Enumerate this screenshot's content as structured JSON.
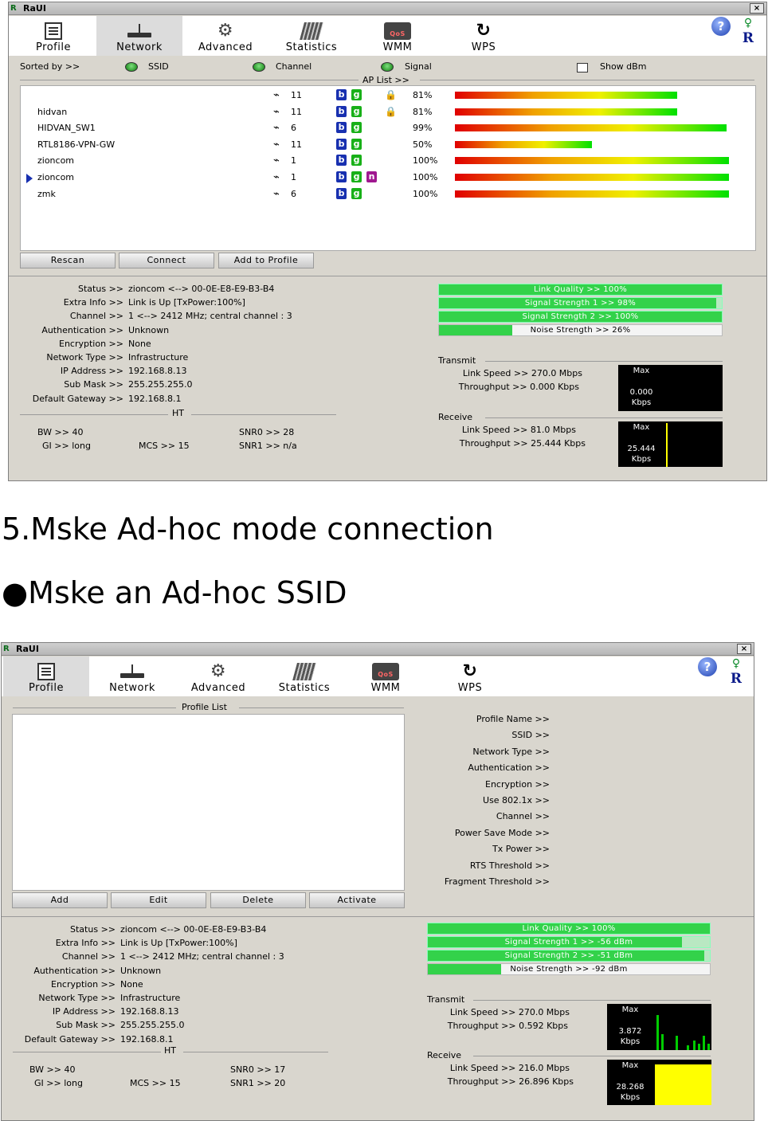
{
  "window1": {
    "title": "RaUI",
    "close": "×",
    "tabs": [
      {
        "label": "Profile",
        "icon": "profile-icon"
      },
      {
        "label": "Network",
        "icon": "network-icon"
      },
      {
        "label": "Advanced",
        "icon": "advanced-icon"
      },
      {
        "label": "Statistics",
        "icon": "statistics-icon"
      },
      {
        "label": "WMM",
        "icon": "wmm-icon"
      },
      {
        "label": "WPS",
        "icon": "wps-icon"
      }
    ],
    "help": "?",
    "sorted_by": "Sorted by >>",
    "sort_options": [
      "SSID",
      "Channel",
      "Signal"
    ],
    "show_dbm": "Show dBm",
    "ap_list_label": "AP List >>",
    "ap_list": [
      {
        "ssid": "",
        "channel": "11",
        "modes": [
          "b",
          "g"
        ],
        "lock": true,
        "signal": "81%",
        "signal_value": 81
      },
      {
        "ssid": "hidvan",
        "channel": "11",
        "modes": [
          "b",
          "g"
        ],
        "lock": true,
        "signal": "81%",
        "signal_value": 81
      },
      {
        "ssid": "HIDVAN_SW1",
        "channel": "6",
        "modes": [
          "b",
          "g"
        ],
        "lock": false,
        "signal": "99%",
        "signal_value": 99
      },
      {
        "ssid": "RTL8186-VPN-GW",
        "channel": "11",
        "modes": [
          "b",
          "g"
        ],
        "lock": false,
        "signal": "50%",
        "signal_value": 50
      },
      {
        "ssid": "zioncom",
        "channel": "1",
        "modes": [
          "b",
          "g"
        ],
        "lock": false,
        "signal": "100%",
        "signal_value": 100
      },
      {
        "ssid": "zioncom",
        "channel": "1",
        "modes": [
          "b",
          "g",
          "n"
        ],
        "lock": false,
        "signal": "100%",
        "signal_value": 100,
        "selected": true
      },
      {
        "ssid": "zmk",
        "channel": "6",
        "modes": [
          "b",
          "g"
        ],
        "lock": false,
        "signal": "100%",
        "signal_value": 100
      }
    ],
    "buttons": {
      "rescan": "Rescan",
      "connect": "Connect",
      "add_to_profile": "Add to Profile"
    },
    "status": [
      {
        "label": "Status >>",
        "value": "zioncom <--> 00-0E-E8-E9-B3-B4"
      },
      {
        "label": "Extra Info >>",
        "value": "Link is Up  [TxPower:100%]"
      },
      {
        "label": "Channel >>",
        "value": "1 <--> 2412 MHz; central channel : 3"
      },
      {
        "label": "Authentication >>",
        "value": "Unknown"
      },
      {
        "label": "Encryption >>",
        "value": "None"
      },
      {
        "label": "Network Type >>",
        "value": "Infrastructure"
      },
      {
        "label": "IP Address >>",
        "value": "192.168.8.13"
      },
      {
        "label": "Sub Mask >>",
        "value": "255.255.255.0"
      },
      {
        "label": "Default Gateway >>",
        "value": "192.168.8.1"
      }
    ],
    "ht_label": "HT",
    "ht": {
      "bw": "BW >> 40",
      "gi": "GI >> long",
      "mcs": "MCS >> 15",
      "snr0": "SNR0 >> 28",
      "snr1": "SNR1 >> n/a"
    },
    "quality": [
      {
        "label": "Link Quality >> 100%",
        "value": 100
      },
      {
        "label": "Signal Strength 1 >> 98%",
        "value": 98
      },
      {
        "label": "Signal Strength 2 >> 100%",
        "value": 100
      },
      {
        "label": "Noise Strength >> 26%",
        "value": 26
      }
    ],
    "transmit_label": "Transmit",
    "transmit": {
      "link_speed": "Link Speed >> 270.0 Mbps",
      "throughput": "Throughput >> 0.000 Kbps",
      "max": "Max",
      "graph_value": "0.000",
      "graph_unit": "Kbps"
    },
    "receive_label": "Receive",
    "receive": {
      "link_speed": "Link Speed >> 81.0 Mbps",
      "throughput": "Throughput >> 25.444 Kbps",
      "max": "Max",
      "graph_value": "25.444",
      "graph_unit": "Kbps"
    }
  },
  "heading1": "5.Mske Ad-hoc mode connection",
  "heading2": "●Mske an Ad-hoc SSID",
  "window2": {
    "title": "RaUI",
    "close": "×",
    "tabs": [
      {
        "label": "Profile",
        "icon": "profile-icon"
      },
      {
        "label": "Network",
        "icon": "network-icon"
      },
      {
        "label": "Advanced",
        "icon": "advanced-icon"
      },
      {
        "label": "Statistics",
        "icon": "statistics-icon"
      },
      {
        "label": "WMM",
        "icon": "wmm-icon"
      },
      {
        "label": "WPS",
        "icon": "wps-icon"
      }
    ],
    "help": "?",
    "profile_list_label": "Profile List",
    "profile_fields": [
      "Profile Name >>",
      "SSID >>",
      "Network Type >>",
      "Authentication >>",
      "Encryption >>",
      "Use 802.1x >>",
      "Channel >>",
      "Power Save Mode >>",
      "Tx Power >>",
      "RTS Threshold >>",
      "Fragment Threshold >>"
    ],
    "buttons": {
      "add": "Add",
      "edit": "Edit",
      "delete": "Delete",
      "activate": "Activate"
    },
    "status": [
      {
        "label": "Status >>",
        "value": "zioncom <--> 00-0E-E8-E9-B3-B4"
      },
      {
        "label": "Extra Info >>",
        "value": "Link is Up  [TxPower:100%]"
      },
      {
        "label": "Channel >>",
        "value": "1 <--> 2412 MHz; central channel : 3"
      },
      {
        "label": "Authentication >>",
        "value": "Unknown"
      },
      {
        "label": "Encryption >>",
        "value": "None"
      },
      {
        "label": "Network Type >>",
        "value": "Infrastructure"
      },
      {
        "label": "IP Address >>",
        "value": "192.168.8.13"
      },
      {
        "label": "Sub Mask >>",
        "value": "255.255.255.0"
      },
      {
        "label": "Default Gateway >>",
        "value": "192.168.8.1"
      }
    ],
    "ht_label": "HT",
    "ht": {
      "bw": "BW >> 40",
      "gi": "GI >> long",
      "mcs": "MCS >> 15",
      "snr0": "SNR0 >> 17",
      "snr1": "SNR1 >> 20"
    },
    "quality": [
      {
        "label": "Link Quality >> 100%",
        "value": 100
      },
      {
        "label": "Signal Strength 1 >> -56 dBm",
        "value": 90
      },
      {
        "label": "Signal Strength 2 >> -51 dBm",
        "value": 98
      },
      {
        "label": "Noise Strength >> -92 dBm",
        "value": 26
      }
    ],
    "transmit_label": "Transmit",
    "transmit": {
      "link_speed": "Link Speed >> 270.0 Mbps",
      "throughput": "Throughput >> 0.592 Kbps",
      "max": "Max",
      "graph_value": "3.872",
      "graph_unit": "Kbps"
    },
    "receive_label": "Receive",
    "receive": {
      "link_speed": "Link Speed >> 216.0 Mbps",
      "throughput": "Throughput >> 26.896 Kbps",
      "max": "Max",
      "graph_value": "28.268",
      "graph_unit": "Kbps"
    }
  }
}
